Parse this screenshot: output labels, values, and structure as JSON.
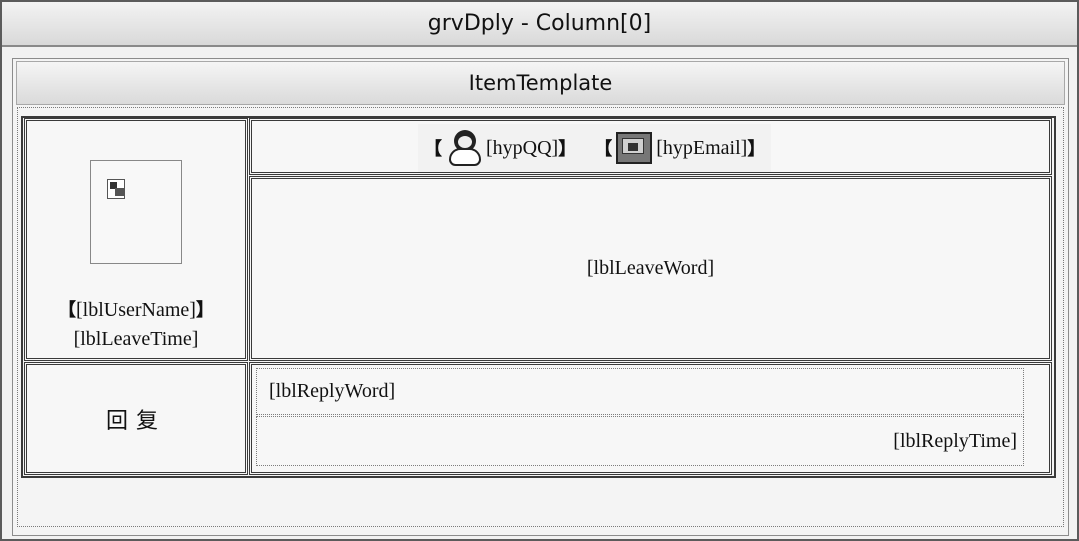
{
  "window": {
    "title": "grvDply - Column[0]"
  },
  "template": {
    "header": "ItemTemplate"
  },
  "user_cell": {
    "bracket_open": "【",
    "username": "[lblUserName]",
    "bracket_close": "】",
    "leave_time": "[lblLeaveTime]"
  },
  "links_row": {
    "qq_bracket_open": "【",
    "qq_link": "[hypQQ]",
    "qq_bracket_close": "】",
    "email_bracket_open": "【",
    "email_link": "[hypEmail]",
    "email_bracket_close": "】",
    "icons": [
      "qq-icon",
      "email-icon"
    ]
  },
  "leave_word": {
    "label": "[lblLeaveWord]"
  },
  "reply": {
    "label": "回复",
    "reply_word": "[lblReplyWord]",
    "reply_time": "[lblReplyTime]"
  }
}
